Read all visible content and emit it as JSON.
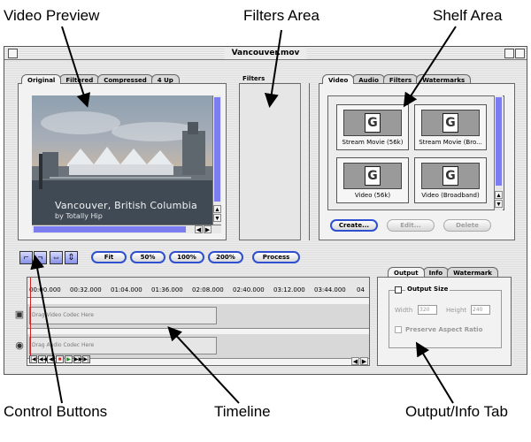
{
  "callouts": {
    "video_preview": "Video Preview",
    "filters_area": "Filters Area",
    "shelf_area": "Shelf Area",
    "control_buttons": "Control Buttons",
    "timeline": "Timeline",
    "output_info_tab": "Output/Info Tab"
  },
  "window": {
    "title": "Vancouver.mov"
  },
  "video_tabs": [
    "Original",
    "Filtered",
    "Compressed",
    "4 Up"
  ],
  "video": {
    "caption_line1": "Vancouver, British Columbia",
    "caption_line2": "by Totally Hip"
  },
  "filters": {
    "label": "Filters"
  },
  "shelf_tabs": [
    "Video",
    "Audio",
    "Filters",
    "Watermarks"
  ],
  "presets": [
    "Stream Movie (56k)",
    "Stream Movie (Bro...",
    "Video (56k)",
    "Video (Broadband)"
  ],
  "preset_icon_glyph": "G",
  "shelf_buttons": {
    "create": "Create...",
    "edit": "Edit...",
    "delete": "Delete"
  },
  "zoom_buttons": [
    "Fit",
    "50%",
    "100%",
    "200%"
  ],
  "process_label": "Process",
  "control_icons": [
    "in-point-icon",
    "out-point-icon",
    "fit-horizontal-icon",
    "fit-vertical-icon"
  ],
  "timeline": {
    "ticks": [
      "00:00.000",
      "00:32.000",
      "01:04.000",
      "01:36.000",
      "02:08.000",
      "02:40.000",
      "03:12.000",
      "03:44.000",
      "04"
    ],
    "video_track": "Drag Video Codec Here",
    "audio_track": "Drag Audio Codec Here"
  },
  "output_tabs": [
    "Output",
    "Info",
    "Watermark"
  ],
  "output": {
    "size_label": "Output Size",
    "width_label": "Width",
    "width_value": "320",
    "height_label": "Height",
    "height_value": "240",
    "aspect_label": "Preserve Aspect Ratio"
  },
  "colors": {
    "accent": "#2d4fd0",
    "scroll_thumb": "#7b7df0",
    "playhead": "#d02020"
  }
}
